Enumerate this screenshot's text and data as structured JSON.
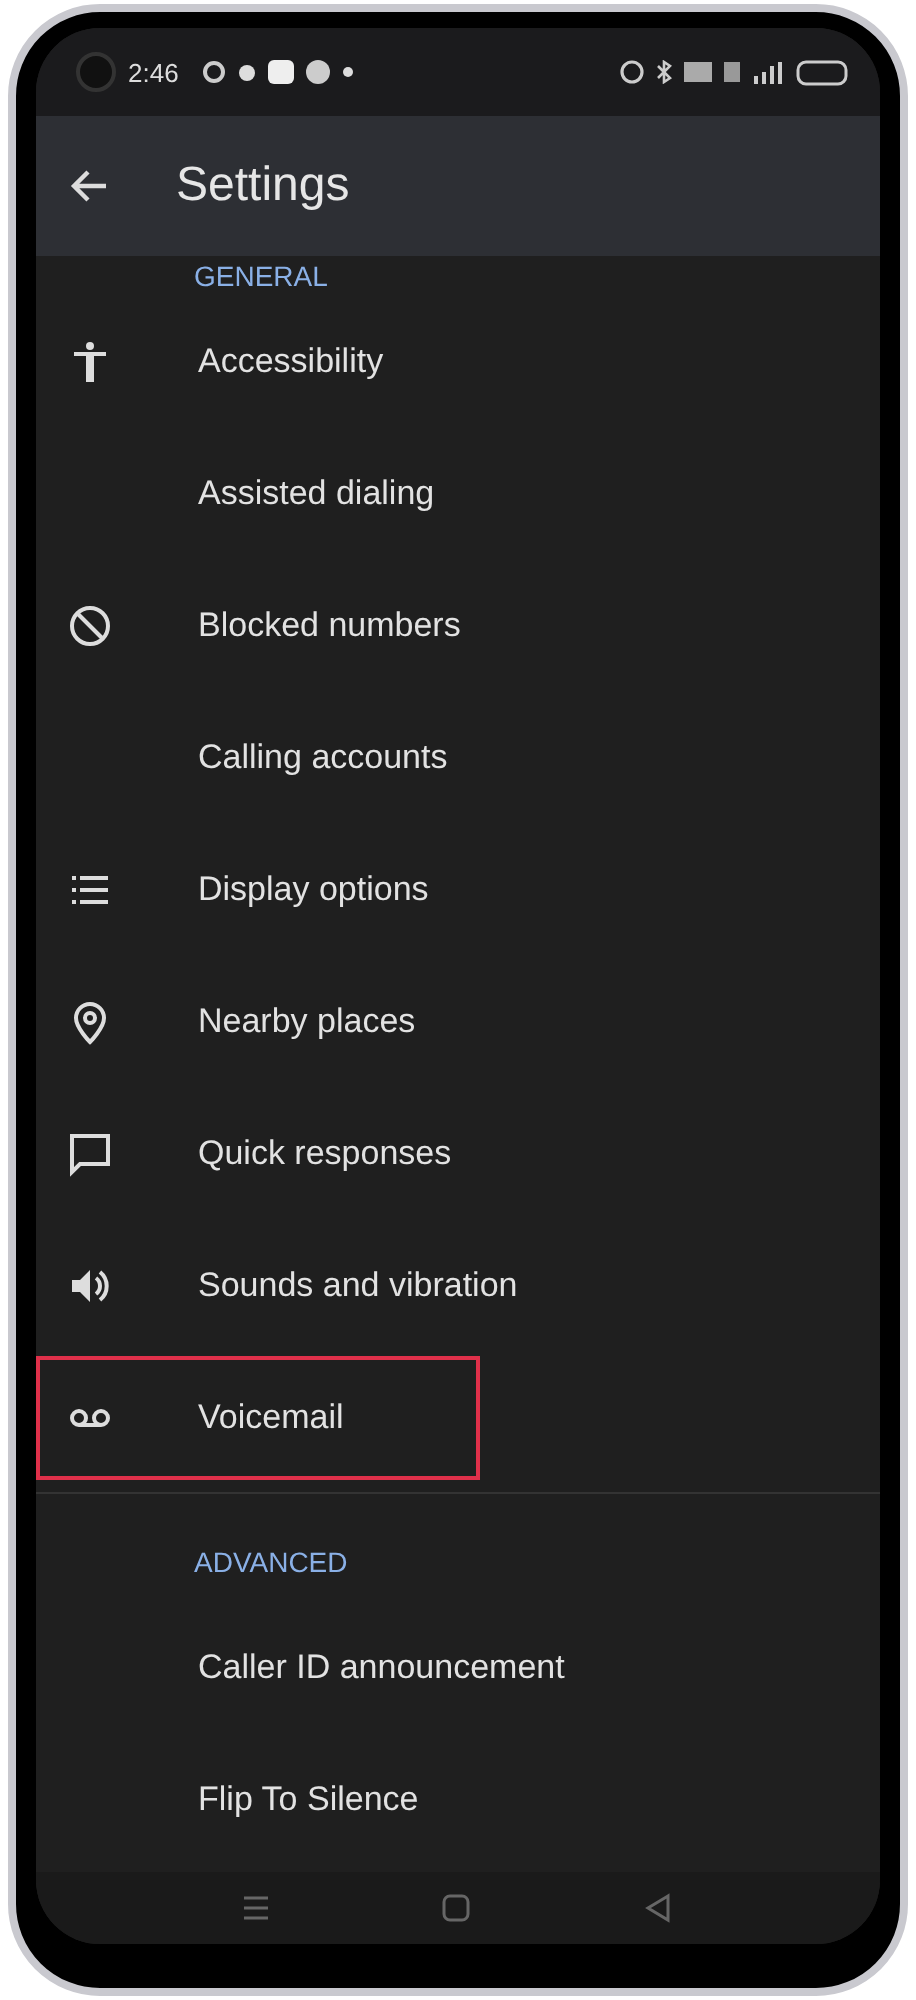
{
  "status_bar": {
    "time": "2:46"
  },
  "app_bar": {
    "title": "Settings"
  },
  "sections": [
    {
      "header": "GENERAL",
      "items": [
        {
          "label": "Accessibility",
          "kind": "accessibility",
          "highlighted": false
        },
        {
          "label": "Assisted dialing",
          "kind": "plain",
          "highlighted": false
        },
        {
          "label": "Blocked numbers",
          "kind": "blocked",
          "highlighted": false
        },
        {
          "label": "Calling accounts",
          "kind": "plain",
          "highlighted": false
        },
        {
          "label": "Display options",
          "kind": "list",
          "highlighted": false
        },
        {
          "label": "Nearby places",
          "kind": "pin",
          "highlighted": false
        },
        {
          "label": "Quick responses",
          "kind": "message",
          "highlighted": false
        },
        {
          "label": "Sounds and vibration",
          "kind": "volume",
          "highlighted": false
        },
        {
          "label": "Voicemail",
          "kind": "voicemail",
          "highlighted": true
        }
      ]
    },
    {
      "header": "ADVANCED",
      "items": [
        {
          "label": "Caller ID announcement",
          "kind": "plain",
          "highlighted": false
        },
        {
          "label": "Flip To Silence",
          "kind": "plain",
          "highlighted": false
        }
      ]
    }
  ]
}
